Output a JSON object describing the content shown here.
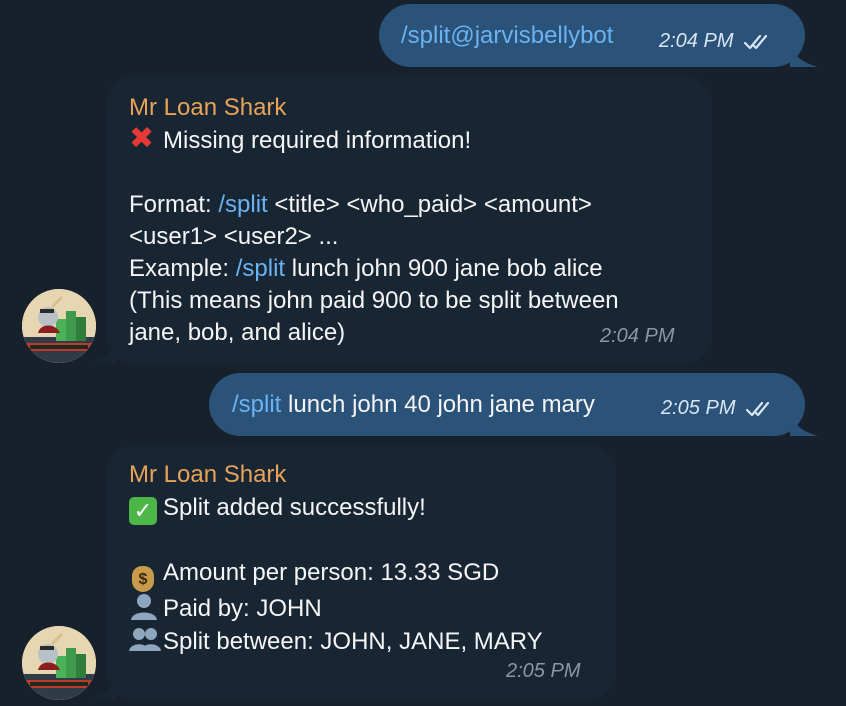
{
  "messages": [
    {
      "direction": "outgoing",
      "parts": [
        {
          "text": "/split@jarvisbellybot",
          "kind": "command"
        }
      ],
      "time": "2:04 PM",
      "status": "read"
    },
    {
      "direction": "incoming",
      "sender": "Mr Loan Shark",
      "lines": [
        {
          "emoji": "cross-mark",
          "text": "Missing required information!"
        },
        {
          "text": ""
        },
        {
          "prefix": "Format: ",
          "command": "/split",
          "text": " <title> <who_paid> <amount>"
        },
        {
          "text": "<user1> <user2> ..."
        },
        {
          "prefix": "Example: ",
          "command": "/split",
          "text": " lunch john 900 jane bob alice"
        },
        {
          "text": "(This means john paid 900 to be split between"
        },
        {
          "text": "jane, bob, and alice)"
        }
      ],
      "time": "2:04 PM"
    },
    {
      "direction": "outgoing",
      "parts": [
        {
          "text": "/split",
          "kind": "command"
        },
        {
          "text": " lunch john 40 john jane mary",
          "kind": "text"
        }
      ],
      "time": "2:05 PM",
      "status": "read"
    },
    {
      "direction": "incoming",
      "sender": "Mr Loan Shark",
      "lines": [
        {
          "emoji": "check-mark",
          "text": "Split added successfully!"
        },
        {
          "text": ""
        },
        {
          "emoji": "money-bag",
          "text": "Amount per person: 13.33 SGD"
        },
        {
          "emoji": "person-silhouette",
          "text": "Paid by: JOHN"
        },
        {
          "emoji": "people-silhouette",
          "text": "Split between: JOHN, JANE, MARY"
        }
      ],
      "time": "2:05 PM"
    }
  ],
  "colors": {
    "background": "#17212b",
    "outgoing_bubble": "#2b5278",
    "incoming_bubble": "#182533",
    "sender_name": "#e7a357",
    "command_link": "#6ab3f3",
    "timestamp": "#8b97a3"
  }
}
